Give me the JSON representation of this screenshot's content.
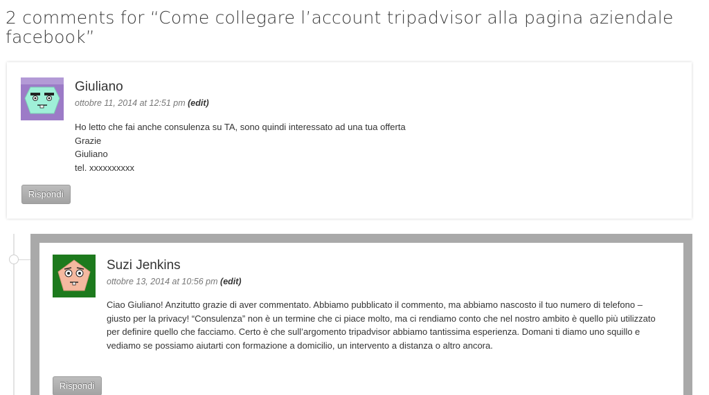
{
  "page": {
    "heading": "2 comments for “Come collegare l’account tripadvisor alla pagina aziendale facebook”"
  },
  "comments": [
    {
      "author": "Giuliano",
      "date": "ottobre 11, 2014 at 12:51 pm",
      "edit_label": "(edit)",
      "lines": [
        "Ho letto che fai anche consulenza su TA, sono quindi interessato ad una tua offerta",
        "Grazie",
        "Giuliano",
        "tel. xxxxxxxxxx"
      ],
      "reply_label": "Rispondi",
      "avatar": "identicon-avatar",
      "avatar_colors": {
        "bg": "#9c7bc7",
        "face": "#9ff0d8"
      }
    },
    {
      "author": "Suzi Jenkins",
      "date": "ottobre 13, 2014 at 10:56 pm",
      "edit_label": "(edit)",
      "text": "Ciao Giuliano! Anzitutto grazie di aver commentato. Abbiamo pubblicato il commento, ma abbiamo nascosto il tuo numero di telefono – giusto per la privacy! “Consulenza” non è un termine che ci piace molto, ma ci rendiamo conto che nel nostro ambito è quello più utilizzato per definire quello che facciamo. Certo è che sull’argomento tripadvisor abbiamo tantissima esperienza. Domani ti diamo uno squillo e vediamo se possiamo aiutarti con formazione a domicilio, un intervento a distanza o altro ancora.",
      "reply_label": "Rispondi",
      "avatar": "identicon-avatar",
      "avatar_colors": {
        "bg": "#1d7a1d",
        "face": "#f5b9a0"
      }
    }
  ],
  "colors": {
    "reply_frame": "#a9a9a9",
    "button": "#b0b0b0"
  }
}
